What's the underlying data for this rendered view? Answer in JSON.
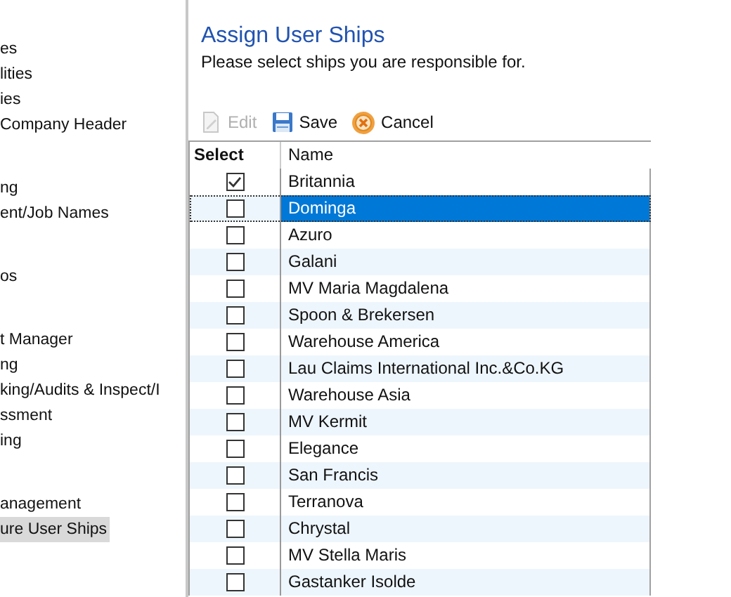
{
  "sidebar": {
    "groups": [
      {
        "items": [
          {
            "label": "es",
            "selected": false
          },
          {
            "label": "lities",
            "selected": false
          },
          {
            "label": "ies",
            "selected": false
          },
          {
            "label": "Company Header",
            "selected": false
          }
        ]
      },
      {
        "items": [
          {
            "label": "ng",
            "selected": false
          },
          {
            "label": "ent/Job Names",
            "selected": false
          }
        ]
      },
      {
        "items": [
          {
            "label": "os",
            "selected": false
          }
        ]
      },
      {
        "items": [
          {
            "label": "t Manager",
            "selected": false
          },
          {
            "label": "ng",
            "selected": false
          },
          {
            "label": "king/Audits & Inspect/I",
            "selected": false
          },
          {
            "label": "ssment",
            "selected": false
          },
          {
            "label": "ing",
            "selected": false
          }
        ]
      },
      {
        "items": [
          {
            "label": "anagement",
            "selected": false
          },
          {
            "label": "ure User Ships",
            "selected": true
          }
        ]
      }
    ]
  },
  "title": "Assign User Ships",
  "subtitle": "Please select ships you are responsible for.",
  "toolbar": [
    {
      "kind": "edit",
      "label": "Edit",
      "disabled": true
    },
    {
      "kind": "save",
      "label": "Save",
      "disabled": false
    },
    {
      "kind": "cancel",
      "label": "Cancel",
      "disabled": false
    }
  ],
  "table": {
    "columns": [
      "Select",
      "Name"
    ],
    "rows": [
      {
        "name": "Britannia",
        "checked": true,
        "selected": false
      },
      {
        "name": "Dominga",
        "checked": false,
        "selected": true
      },
      {
        "name": "Azuro",
        "checked": false,
        "selected": false
      },
      {
        "name": "Galani",
        "checked": false,
        "selected": false
      },
      {
        "name": "MV Maria Magdalena",
        "checked": false,
        "selected": false
      },
      {
        "name": "Spoon & Brekersen",
        "checked": false,
        "selected": false
      },
      {
        "name": "Warehouse America",
        "checked": false,
        "selected": false
      },
      {
        "name": "Lau Claims International Inc.&Co.KG",
        "checked": false,
        "selected": false
      },
      {
        "name": "Warehouse Asia",
        "checked": false,
        "selected": false
      },
      {
        "name": "MV Kermit",
        "checked": false,
        "selected": false
      },
      {
        "name": "Elegance",
        "checked": false,
        "selected": false
      },
      {
        "name": "San Francis",
        "checked": false,
        "selected": false
      },
      {
        "name": "Terranova",
        "checked": false,
        "selected": false
      },
      {
        "name": "Chrystal",
        "checked": false,
        "selected": false
      },
      {
        "name": "MV Stella Maris",
        "checked": false,
        "selected": false
      },
      {
        "name": "Gastanker Isolde",
        "checked": false,
        "selected": false
      }
    ]
  }
}
